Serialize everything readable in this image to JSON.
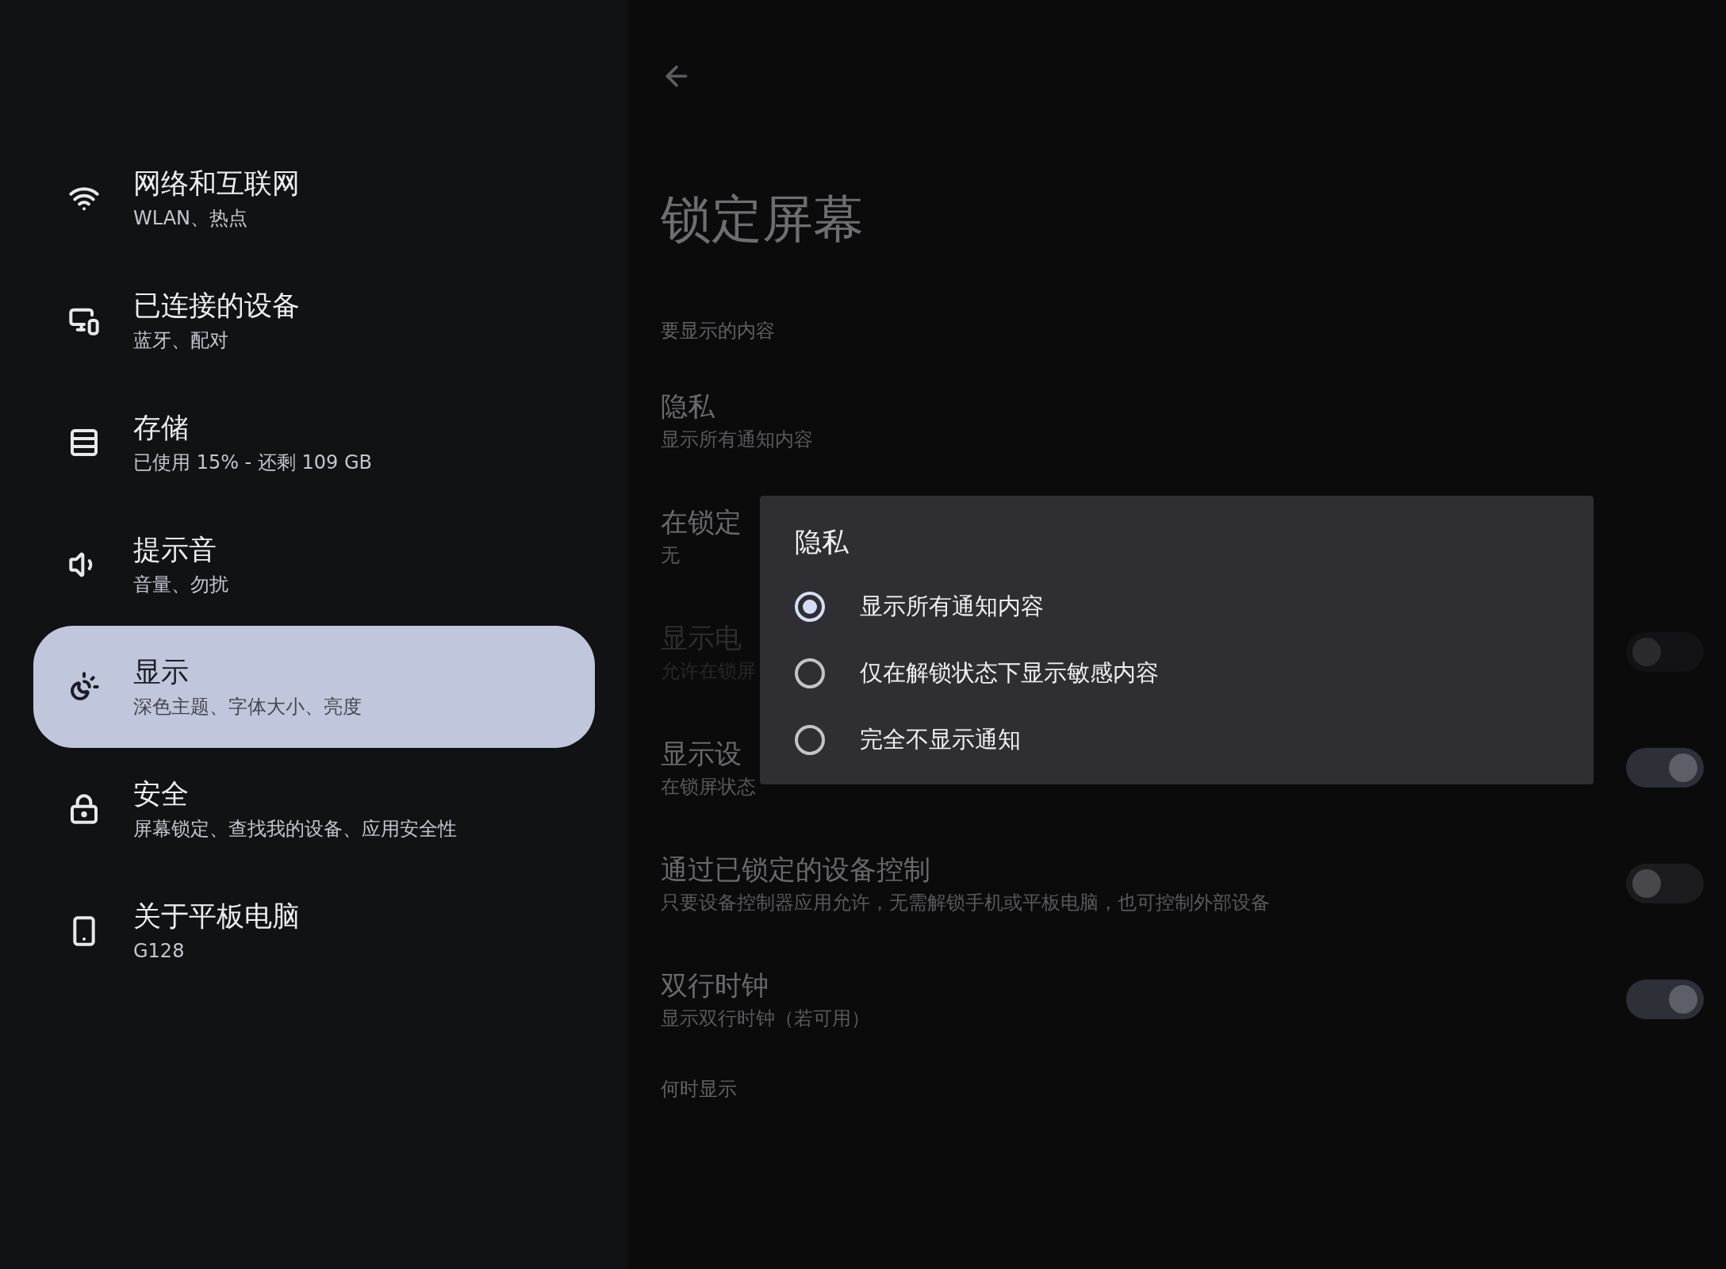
{
  "sidebar": {
    "items": [
      {
        "kind": "wifi",
        "title": "网络和互联网",
        "subtitle": "WLAN、热点",
        "selected": false
      },
      {
        "kind": "devices",
        "title": "已连接的设备",
        "subtitle": "蓝牙、配对",
        "selected": false
      },
      {
        "kind": "storage",
        "title": "存储",
        "subtitle": "已使用 15% - 还剩 109 GB",
        "selected": false
      },
      {
        "kind": "sound",
        "title": "提示音",
        "subtitle": "音量、勿扰",
        "selected": false
      },
      {
        "kind": "display",
        "title": "显示",
        "subtitle": "深色主题、字体大小、亮度",
        "selected": true
      },
      {
        "kind": "security",
        "title": "安全",
        "subtitle": "屏幕锁定、查找我的设备、应用安全性",
        "selected": false
      },
      {
        "kind": "about",
        "title": "关于平板电脑",
        "subtitle": "G128",
        "selected": false
      }
    ]
  },
  "page": {
    "title": "锁定屏幕",
    "rows": [
      {
        "kind": "header",
        "title": "要显示的内容"
      },
      {
        "kind": "text",
        "title": "隐私",
        "subtitle": "显示所有通知内容"
      },
      {
        "kind": "text",
        "title": "在锁定",
        "subtitle": "无"
      },
      {
        "kind": "toggle",
        "title": "显示电",
        "subtitle": "允许在锁屏",
        "on": false,
        "disabled": true
      },
      {
        "kind": "toggle",
        "title": "显示设",
        "subtitle": "在锁屏状态",
        "on": true,
        "disabled": false
      },
      {
        "kind": "toggle",
        "title": "通过已锁定的设备控制",
        "subtitle": "只要设备控制器应用允许，无需解锁手机或平板电脑，也可控制外部设备",
        "on": false,
        "disabled": false
      },
      {
        "kind": "toggle",
        "title": "双行时钟",
        "subtitle": "显示双行时钟（若可用）",
        "on": true,
        "disabled": false
      },
      {
        "kind": "header",
        "title": "何时显示"
      }
    ]
  },
  "dialog": {
    "title": "隐私",
    "options": [
      {
        "label": "显示所有通知内容",
        "selected": true
      },
      {
        "label": "仅在解锁状态下显示敏感内容",
        "selected": false
      },
      {
        "label": "完全不显示通知",
        "selected": false
      }
    ]
  }
}
